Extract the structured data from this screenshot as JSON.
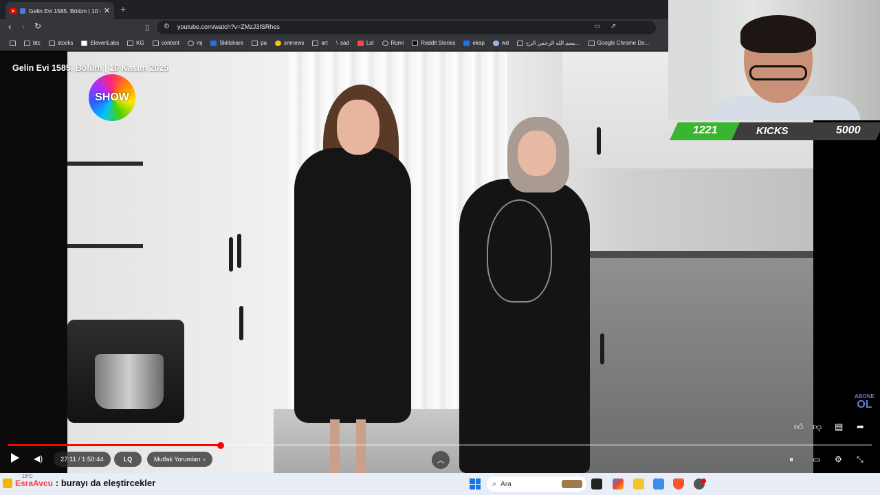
{
  "browser": {
    "tab_title": "Gelin Evi 1585. Bölüm | 10 Kas",
    "tab_close": "✕",
    "new_tab": "+",
    "url": "youtube.com/watch?v=ZMzJ3ISRhes",
    "bookmarks": [
      "btc",
      "stocks",
      "ElevenLabs",
      "KG",
      "content",
      "mj",
      "Skillshare",
      "pa",
      "smnews",
      "art",
      "sad",
      "Lst",
      "Rumi",
      "Reddit Stories",
      "ekap",
      "wd",
      "بسم الله الرحمن الرح...",
      "Google Chrome Do..."
    ]
  },
  "video": {
    "title": "Gelin Evi 1585. Bölüm | 10 Kasım 2025",
    "channel_logo_text": "SHOW",
    "time": "27:11 / 1:50:44",
    "cc_label": "LQ",
    "chapter": "Mutfak Yorumları",
    "chapter_arrow": "›",
    "progress_fraction": 0.246,
    "abone_top": "ABONE",
    "abone_bottom": "OL"
  },
  "subgoal": {
    "current": "1221",
    "label": "KICKS",
    "target": "5000"
  },
  "chat": {
    "user": "EsraAvcu",
    "message": ": burayı da eleştircekler"
  },
  "taskbar": {
    "weather": "19°C",
    "search_placeholder": "Ara"
  },
  "colors": {
    "accent": "#ff0000",
    "subgoal_green": "#3ab52f",
    "taskbar_bg": "#e9eef6"
  }
}
